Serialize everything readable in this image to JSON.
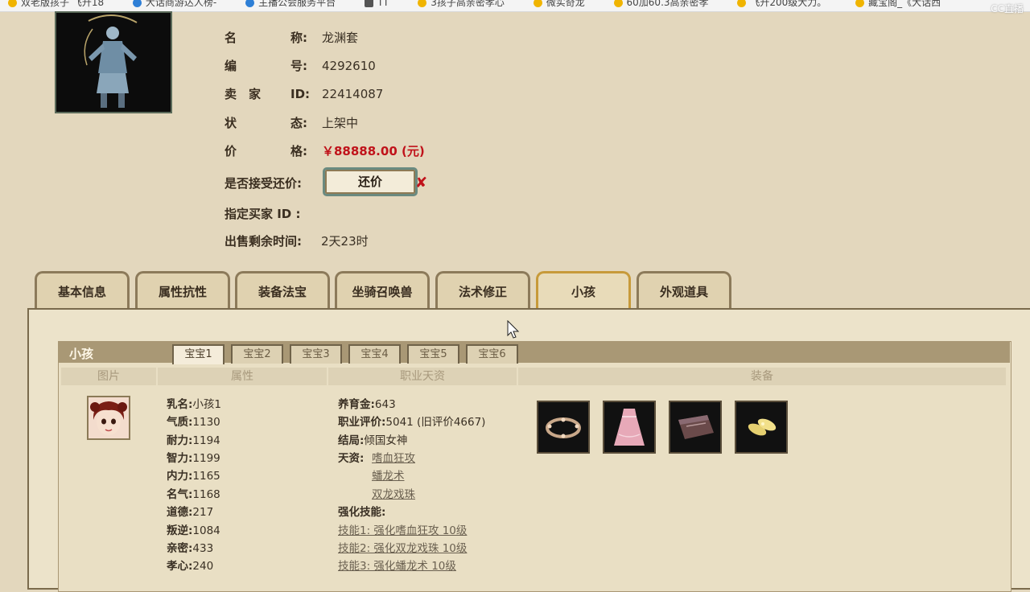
{
  "bookmarks": [
    {
      "label": "双老版孩子 飞升18",
      "icon": "star-icon"
    },
    {
      "label": "大话商游达人榜-",
      "icon": "globe-icon"
    },
    {
      "label": "主播公会服务平台",
      "icon": "globe-icon"
    },
    {
      "label": "TT",
      "icon": "app-icon"
    },
    {
      "label": "3孩子高亲密孝心",
      "icon": "star-icon"
    },
    {
      "label": "微实奇龙",
      "icon": "star-icon"
    },
    {
      "label": "60加60.3高亲密孝",
      "icon": "star-icon"
    },
    {
      "label": "飞升200级大力。",
      "icon": "star-icon"
    },
    {
      "label": "藏宝阁_《大话西",
      "icon": "star-icon"
    }
  ],
  "watermark": "CC直播",
  "item": {
    "name_label_a": "名",
    "name_label_b": "称:",
    "name": "龙渊套",
    "id_label_a": "编",
    "id_label_b": "号:",
    "id": "4292610",
    "seller_label_a": "卖　家",
    "seller_label_b": "ID:",
    "seller_id": "22414087",
    "status_label_a": "状",
    "status_label_b": "态:",
    "status": "上架中",
    "price_label_a": "价",
    "price_label_b": "格:",
    "price": "￥88888.00 (元)",
    "counter_label": "是否接受还价:",
    "counter_button": "还价",
    "counter_mark": "✘",
    "buyer_label": "指定买家 ID :",
    "remain_label": "出售剩余时间:",
    "remain": "2天23时"
  },
  "tabs": [
    {
      "label": "基本信息",
      "active": false
    },
    {
      "label": "属性抗性",
      "active": false
    },
    {
      "label": "装备法宝",
      "active": false
    },
    {
      "label": "坐骑召唤兽",
      "active": false
    },
    {
      "label": "法术修正",
      "active": false
    },
    {
      "label": "小孩",
      "active": true
    },
    {
      "label": "外观道具",
      "active": false
    }
  ],
  "children_panel": {
    "title": "小孩",
    "sub_tabs": [
      "宝宝1",
      "宝宝2",
      "宝宝3",
      "宝宝4",
      "宝宝5",
      "宝宝6"
    ],
    "active_sub_tab": "宝宝1",
    "columns": [
      "图片",
      "属性",
      "职业天资",
      "装备"
    ],
    "attributes": [
      {
        "k": "乳名:",
        "v": "小孩1"
      },
      {
        "k": "气质:",
        "v": "1130"
      },
      {
        "k": "耐力:",
        "v": "1194"
      },
      {
        "k": "智力:",
        "v": "1199"
      },
      {
        "k": "内力:",
        "v": "1165"
      },
      {
        "k": "名气:",
        "v": "1168"
      },
      {
        "k": "道德:",
        "v": "217"
      },
      {
        "k": "叛逆:",
        "v": "1084"
      },
      {
        "k": "亲密:",
        "v": "433"
      },
      {
        "k": "孝心:",
        "v": "240"
      }
    ],
    "career": {
      "nurture_k": "养育金:",
      "nurture_v": "643",
      "rating_k": "职业评价:",
      "rating_v": "5041 (旧评价4667)",
      "ending_k": "结局:",
      "ending_v": "倾国女神",
      "talent_k": "天资:",
      "talents": [
        "嗜血狂攻",
        "蟠龙术",
        "双龙戏珠"
      ],
      "enhance_k": "强化技能:",
      "skills": [
        "技能1: 强化嗜血狂攻 10级",
        "技能2: 强化双龙戏珠 10级",
        "技能3: 强化蟠龙术 10级"
      ]
    },
    "equipment_icons": [
      "wreath-icon",
      "pink-dress-icon",
      "treasure-box-icon",
      "golden-slippers-icon"
    ]
  }
}
